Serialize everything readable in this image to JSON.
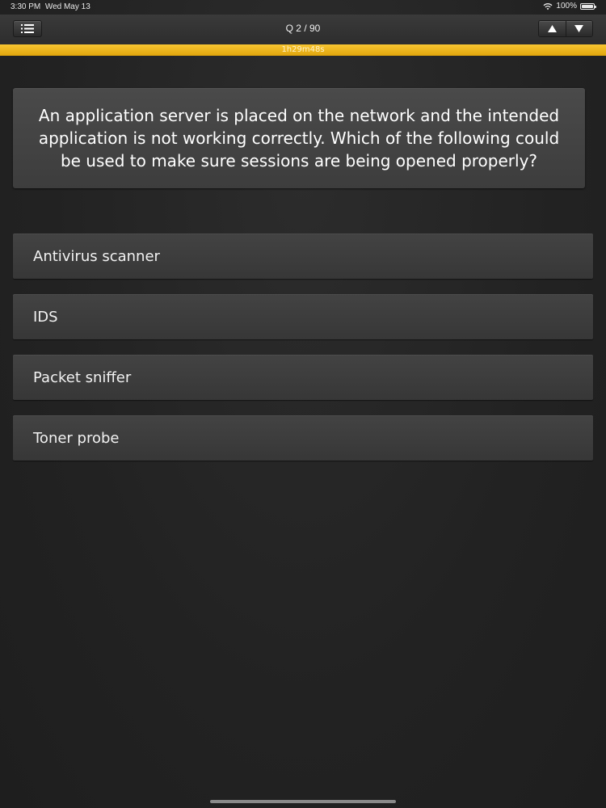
{
  "status_bar": {
    "time": "3:30 PM",
    "date": "Wed May 13",
    "battery": "100%"
  },
  "nav": {
    "title": "Q 2 / 90",
    "menu_icon": "list-icon",
    "prev_icon": "arrow-up-icon",
    "next_icon": "arrow-down-icon"
  },
  "timer": {
    "text": "1h29m48s",
    "progress": 1.0,
    "color": "#f0b51e"
  },
  "question": {
    "text": "An application server is placed on the network and the intended application is not working correctly. Which of the following could be used to make sure sessions are being opened properly?"
  },
  "answers": [
    {
      "label": "Antivirus scanner"
    },
    {
      "label": "IDS"
    },
    {
      "label": "Packet sniffer"
    },
    {
      "label": "Toner probe"
    }
  ]
}
